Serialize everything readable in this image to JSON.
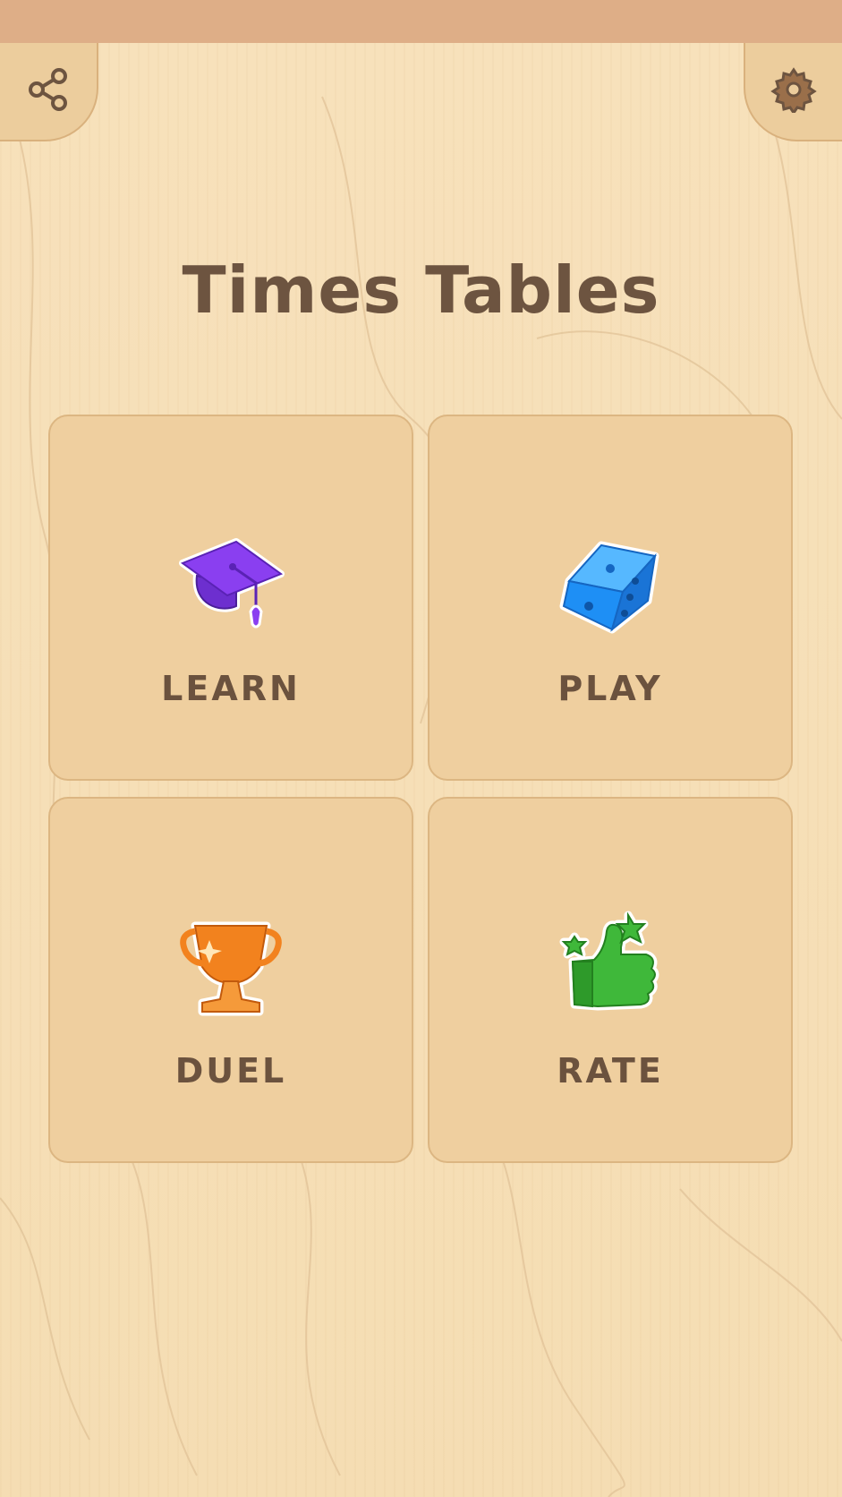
{
  "header": {
    "share_icon": "share-icon",
    "settings_icon": "gear-icon"
  },
  "title": "Times Tables",
  "menu": [
    {
      "label": "LEARN",
      "icon": "graduation-cap-icon",
      "color": "#8a3ff0"
    },
    {
      "label": "PLAY",
      "icon": "dice-icon",
      "color": "#1e8ff5"
    },
    {
      "label": "DUEL",
      "icon": "trophy-icon",
      "color": "#f2821e"
    },
    {
      "label": "RATE",
      "icon": "thumbs-up-icon",
      "color": "#3fb83a"
    }
  ],
  "colors": {
    "background": "#f6dfb8",
    "tile": "#efcf9f",
    "text": "#6d5440",
    "top_strip": "#deae87"
  }
}
